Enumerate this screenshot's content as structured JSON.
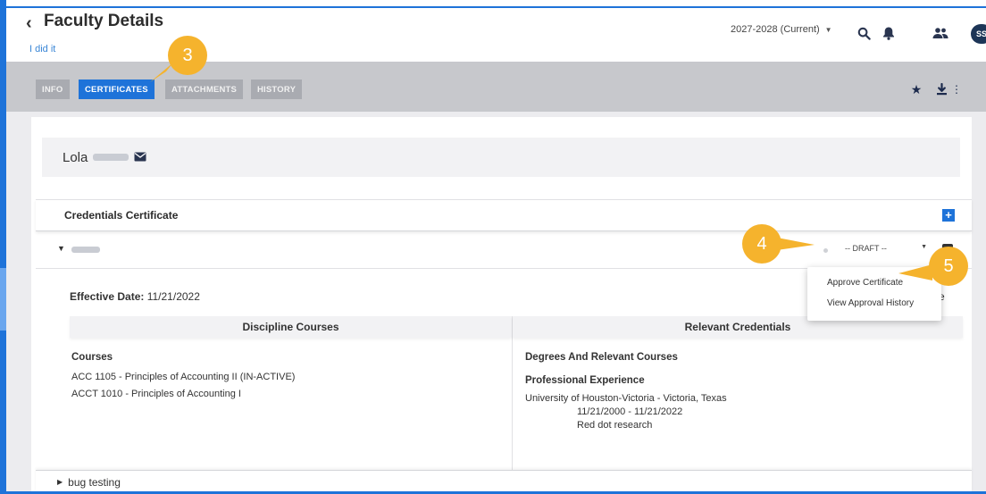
{
  "header": {
    "title": "Faculty Details",
    "subtitle": "I did it",
    "year_selector": "2027-2028 (Current)",
    "avatar_initials": "SS"
  },
  "tabs": [
    {
      "label": "INFO",
      "active": false
    },
    {
      "label": "CERTIFICATES",
      "active": true
    },
    {
      "label": "ATTACHMENTS",
      "active": false
    },
    {
      "label": "HISTORY",
      "active": false
    }
  ],
  "faculty": {
    "first_name": "Lola"
  },
  "credentials": {
    "section_title": "Credentials Certificate",
    "status_select": "-- DRAFT --",
    "effective_date_label": "Effective Date:",
    "effective_date": "11/21/2022",
    "trailing_char": "e"
  },
  "discipline": {
    "header": "Discipline Courses",
    "courses_label": "Courses",
    "courses": [
      "ACC 1105 - Principles of Accounting II (IN-ACTIVE)",
      "ACCT 1010 - Principles of Accounting I"
    ]
  },
  "relevant": {
    "header": "Relevant Credentials",
    "degrees_label": "Degrees And Relevant Courses",
    "experience_label": "Professional Experience",
    "experience_org": "University of Houston-Victoria - Victoria, Texas",
    "experience_dates": "11/21/2000 - 11/21/2022",
    "experience_note": "Red dot research"
  },
  "bug_row": {
    "label": "bug testing"
  },
  "dropdown": {
    "items": [
      "Approve Certificate",
      "View Approval History"
    ]
  },
  "callouts": [
    "3",
    "4",
    "5"
  ],
  "colors": {
    "accent": "#1e73d9",
    "callout": "#f5b32d"
  },
  "icons": [
    "back-chevron-icon",
    "search-icon",
    "bell-icon",
    "users-icon",
    "star-icon",
    "download-icon",
    "more-vertical-icon",
    "envelope-icon",
    "plus-icon"
  ]
}
